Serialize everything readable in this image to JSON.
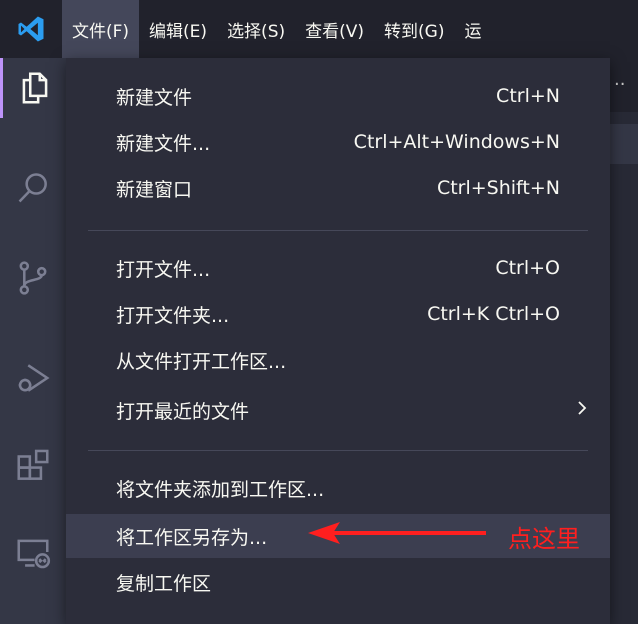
{
  "titlebar": {
    "logo_icon": "vscode-logo-icon",
    "menus": [
      "文件(F)",
      "编辑(E)",
      "选择(S)",
      "查看(V)",
      "转到(G)",
      "运"
    ]
  },
  "activitybar": {
    "icons": [
      "explorer-icon",
      "search-icon",
      "source-control-icon",
      "run-debug-icon",
      "extensions-icon",
      "remote-explorer-icon"
    ]
  },
  "editor": {
    "overflow": "··"
  },
  "file_menu": {
    "items": [
      {
        "label": "新建文件",
        "shortcut": "Ctrl+N"
      },
      {
        "label": "新建文件...",
        "shortcut": "Ctrl+Alt+Windows+N"
      },
      {
        "label": "新建窗口",
        "shortcut": "Ctrl+Shift+N"
      },
      {
        "label": "打开文件...",
        "shortcut": "Ctrl+O"
      },
      {
        "label": "打开文件夹...",
        "shortcut": "Ctrl+K Ctrl+O"
      },
      {
        "label": "从文件打开工作区...",
        "shortcut": ""
      },
      {
        "label": "打开最近的文件",
        "shortcut": "",
        "submenu_icon": "chevron-right-icon"
      },
      {
        "label": "将文件夹添加到工作区...",
        "shortcut": ""
      },
      {
        "label": "将工作区另存为...",
        "shortcut": ""
      },
      {
        "label": "复制工作区",
        "shortcut": ""
      }
    ]
  },
  "annotation": {
    "text": "点这里",
    "color": "#ff1f1f"
  },
  "colors": {
    "menu_bg": "#2c2d3a",
    "highlight": "#3c3e50",
    "accent": "#bd93f9",
    "logo": "#2b9df0"
  }
}
